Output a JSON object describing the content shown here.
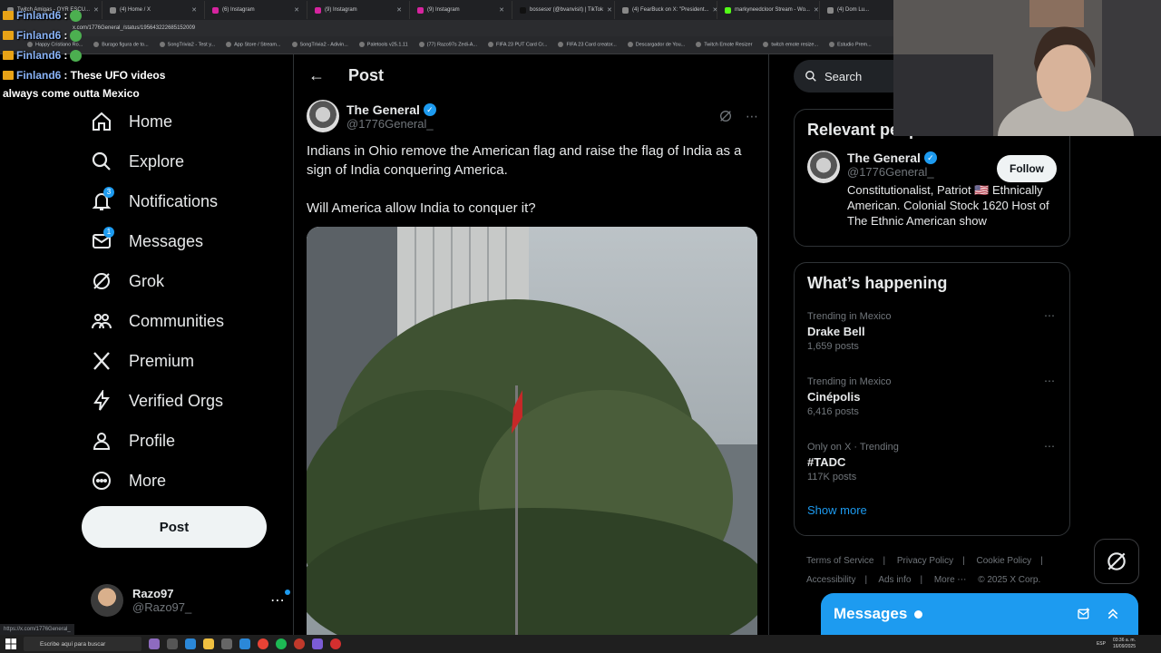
{
  "browser": {
    "tabs": [
      "Twitch Amigas - OYR ESCU...",
      "(4) Home / X",
      "(6) Instagram",
      "(9) Instagram",
      "(9) Instagram",
      "bossesxr (@bvanvisit) | TikTok",
      "(4) FearBuck on X: \"President...",
      "markyneedcloor Stream - Wo...",
      "(4) Dom Lu..."
    ],
    "url": "x.com/1776General_/status/195643222685152009",
    "bookmarks": [
      "Happy Cristiano Ro...",
      "Burago figura de to...",
      "SongTrivia2 - Test y...",
      "App Store / Stream...",
      "SongTrivia2 - Adivin...",
      "Paletools v25.1.11",
      "(77) Razo97s Zedi-A...",
      "FIFA 23 PUT Card Cr...",
      "FIFA 23 Card creator...",
      "Descargador de You...",
      "Twitch Emote Resizer",
      "twitch emote resize...",
      "Estudio Prem..."
    ],
    "status_url": "https://x.com/1776General_"
  },
  "chat": {
    "lines": [
      {
        "user": "Finland6",
        "sep": ":"
      },
      {
        "user": "Finland6",
        "sep": ":"
      },
      {
        "user": "Finland6",
        "sep": ":"
      }
    ],
    "last_user": "Finland6",
    "last_message_a": ": These UFO videos",
    "last_message_b": "always come outta Mexico"
  },
  "nav": {
    "items": [
      {
        "label": "Home",
        "icon": "home-icon"
      },
      {
        "label": "Explore",
        "icon": "search-icon"
      },
      {
        "label": "Notifications",
        "icon": "bell-icon",
        "badge": "3"
      },
      {
        "label": "Messages",
        "icon": "mail-icon",
        "badge": "1"
      },
      {
        "label": "Grok",
        "icon": "grok-icon"
      },
      {
        "label": "Communities",
        "icon": "people-icon"
      },
      {
        "label": "Premium",
        "icon": "x-logo-icon"
      },
      {
        "label": "Verified Orgs",
        "icon": "lightning-icon"
      },
      {
        "label": "Profile",
        "icon": "person-icon"
      },
      {
        "label": "More",
        "icon": "more-circle-icon"
      }
    ],
    "post_label": "Post",
    "account": {
      "name": "Razo97",
      "handle": "@Razo97_",
      "more": "⋯"
    }
  },
  "main": {
    "back": "←",
    "title": "Post",
    "tweet": {
      "display_name": "The General",
      "handle": "@1776General_",
      "text_1": "Indians in Ohio remove the American flag and raise the flag of India as a sign of India conquering America.",
      "text_2": "Will America allow India to conquer it?",
      "more": "⋯"
    }
  },
  "sidebar": {
    "search_placeholder": "Search",
    "relevant_title": "Relevant people",
    "relevant": {
      "name": "The General",
      "handle": "@1776General_",
      "bio": "Constitutionalist, Patriot 🇺🇸 Ethnically American. Colonial Stock 1620 Host of The Ethnic American show",
      "follow_label": "Follow"
    },
    "happening_title": "What’s happening",
    "trends": [
      {
        "category": "Trending in Mexico",
        "name": "Drake Bell",
        "count": "1,659 posts"
      },
      {
        "category": "Trending in Mexico",
        "name": "Cinépolis",
        "count": "6,416 posts"
      },
      {
        "category": "Only on X · Trending",
        "name": "#TADC",
        "count": "117K posts"
      }
    ],
    "show_more": "Show more",
    "footer": [
      "Terms of Service",
      "Privacy Policy",
      "Cookie Policy",
      "Accessibility",
      "Ads info",
      "More ⋯",
      "© 2025 X Corp."
    ]
  },
  "messages_drawer": {
    "title": "Messages"
  },
  "taskbar": {
    "search_placeholder": "Escribe aquí para buscar",
    "lang": "ESP",
    "time": "03:36 a. m.",
    "date": "16/09/2025"
  }
}
